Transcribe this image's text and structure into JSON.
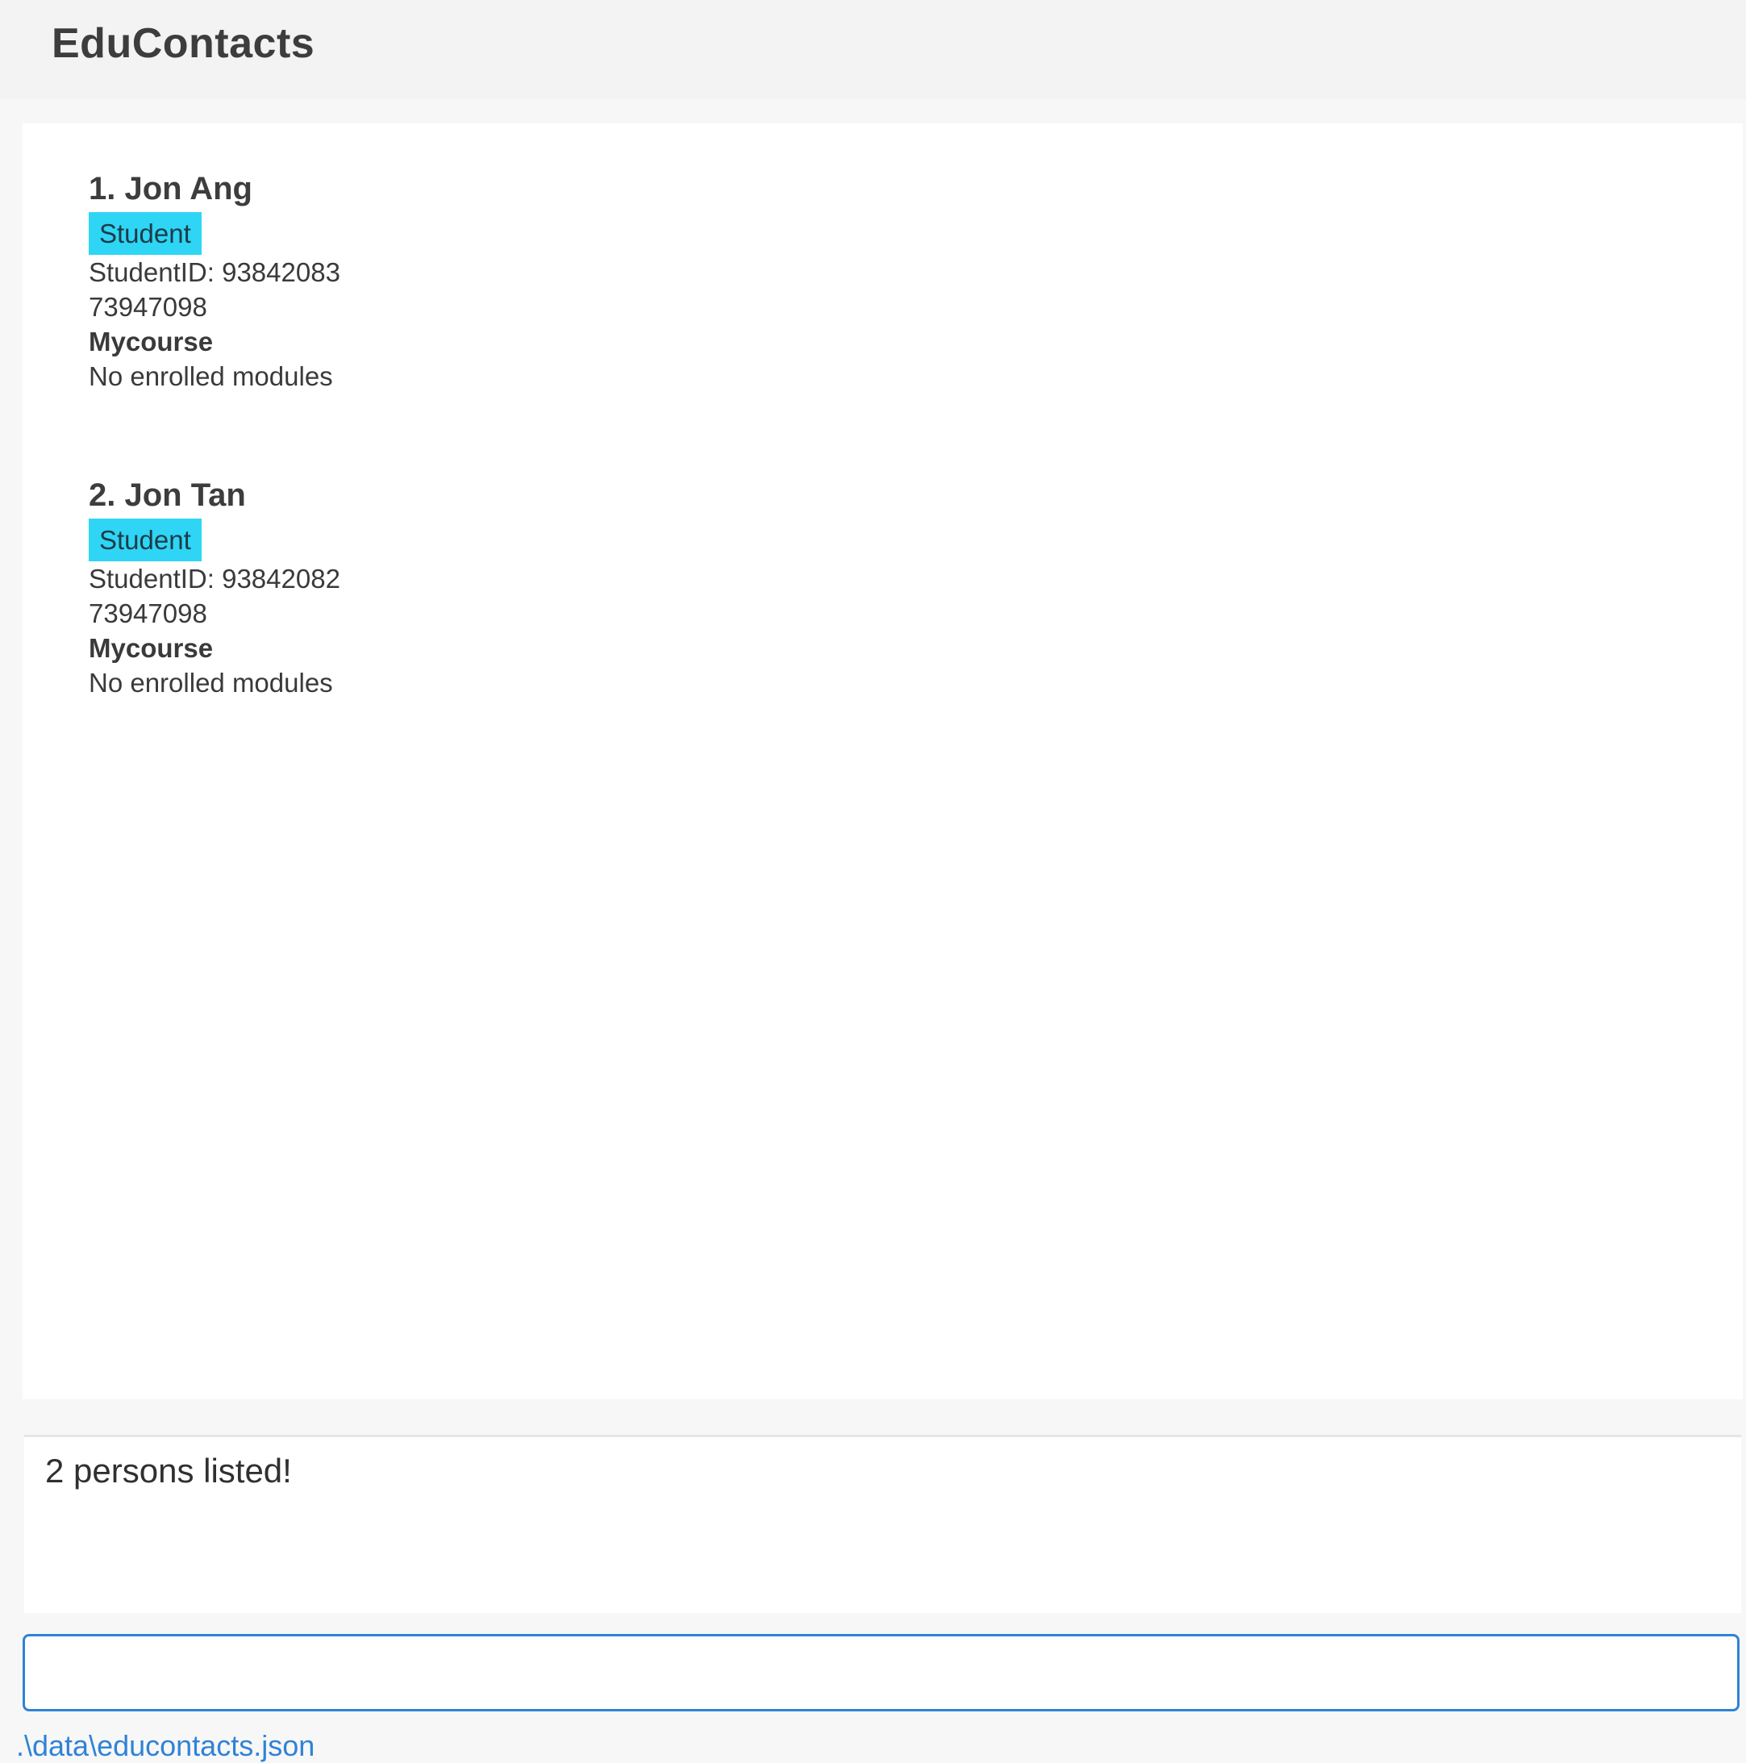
{
  "app": {
    "title": "EduContacts"
  },
  "persons": [
    {
      "heading": "1. Jon Ang",
      "tag": "Student",
      "student_id": "StudentID: 93842083",
      "phone": "73947098",
      "course": "Mycourse",
      "modules": "No enrolled modules"
    },
    {
      "heading": "2. Jon Tan",
      "tag": "Student",
      "student_id": "StudentID: 93842082",
      "phone": "73947098",
      "course": "Mycourse",
      "modules": "No enrolled modules"
    }
  ],
  "result": {
    "message": "2 persons listed!"
  },
  "command": {
    "value": "",
    "placeholder": ""
  },
  "status": {
    "file_path": ".\\data\\educontacts.json"
  },
  "colors": {
    "tag_background": "#2ed5f5",
    "command_border": "#2f83d6",
    "status_text": "#2f83d6"
  }
}
